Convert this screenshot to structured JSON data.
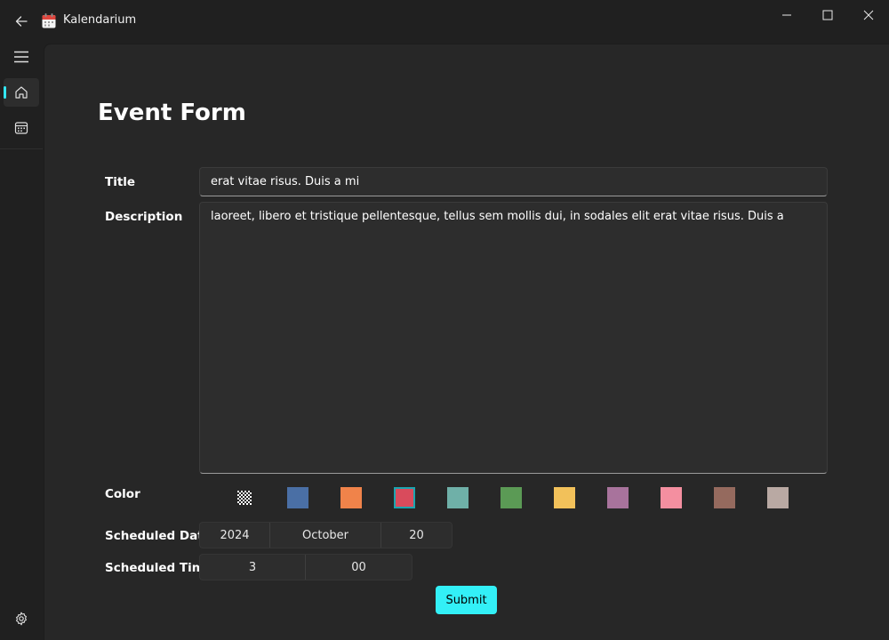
{
  "window": {
    "title": "Kalendarium",
    "icons": {
      "back": "back-arrow-icon",
      "app": "calendar-app-icon",
      "minimize": "minimize-icon",
      "maximize": "maximize-icon",
      "close": "close-icon"
    }
  },
  "nav": {
    "items": [
      {
        "name": "menu",
        "icon": "hamburger-icon"
      },
      {
        "name": "home",
        "icon": "home-icon",
        "selected": true
      },
      {
        "name": "calendar",
        "icon": "calendar-grid-icon"
      },
      {
        "name": "settings",
        "icon": "gear-icon"
      }
    ],
    "accent_color": "#33e6f2"
  },
  "form": {
    "heading": "Event Form",
    "title_label": "Title",
    "title_value": "erat vitae risus. Duis a mi",
    "description_label": "Description",
    "description_value": "laoreet, libero et tristique pellentesque, tellus sem mollis dui, in sodales elit erat vitae risus. Duis a",
    "color_label": "Color",
    "colors": [
      "transparent",
      "#4a6fa5",
      "#f0834a",
      "#d94b5c",
      "#6fb0a8",
      "#5b9a55",
      "#f2c15a",
      "#a8739c",
      "#f48fa0",
      "#956a5e",
      "#b9a9a3"
    ],
    "selected_color_index": 3,
    "date_label": "Scheduled Date",
    "date": {
      "year": "2024",
      "month": "October",
      "day": "20"
    },
    "time_label": "Scheduled Time",
    "time": {
      "hour": "3",
      "minute": "00"
    },
    "submit_label": "Submit",
    "submit_color": "#33f0f7"
  }
}
